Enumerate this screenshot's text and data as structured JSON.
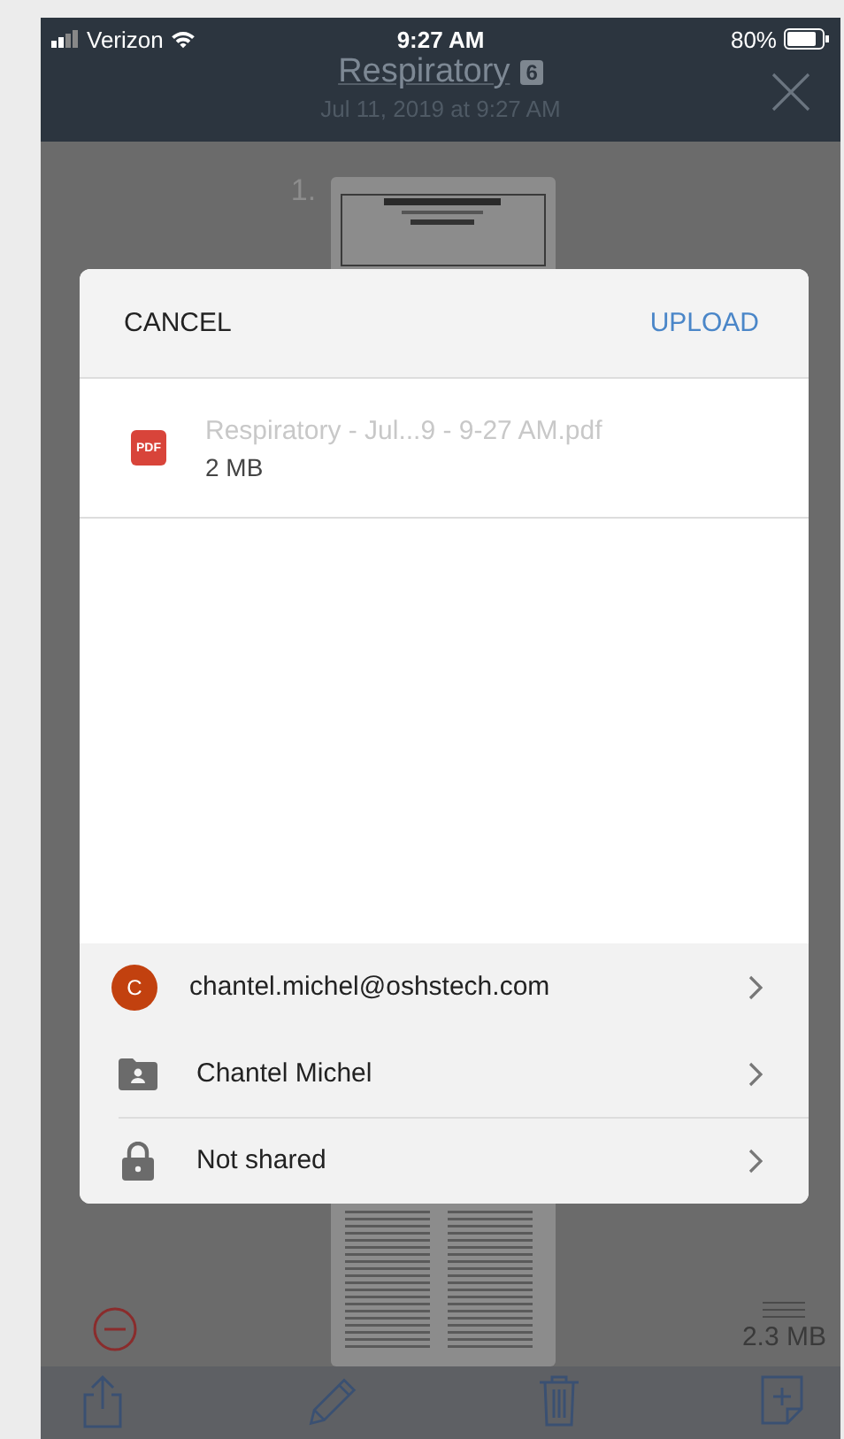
{
  "status_bar": {
    "carrier": "Verizon",
    "time": "9:27 AM",
    "battery": "80%"
  },
  "header": {
    "title": "Respiratory",
    "badge": "6",
    "subtitle": "Jul 11, 2019 at 9:27 AM"
  },
  "page": {
    "number": "1.",
    "size": "2.3 MB"
  },
  "dialog": {
    "cancel": "CANCEL",
    "upload": "UPLOAD",
    "file": {
      "type_badge": "PDF",
      "name": "Respiratory - Jul...9 - 9-27 AM.pdf",
      "size": "2 MB"
    },
    "destinations": [
      {
        "kind": "account",
        "initial": "C",
        "label": "chantel.michel@oshstech.com"
      },
      {
        "kind": "folder",
        "label": "Chantel Michel"
      },
      {
        "kind": "sharing",
        "label": "Not shared"
      }
    ]
  }
}
